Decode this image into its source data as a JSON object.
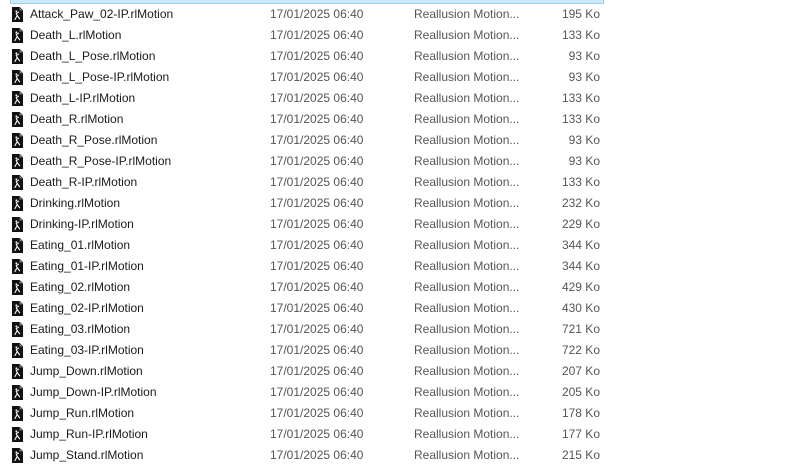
{
  "files": [
    {
      "name": "Attack_Paw_02-IP.rlMotion",
      "date": "17/01/2025 06:40",
      "type": "Reallusion Motion...",
      "size": "195 Ko"
    },
    {
      "name": "Death_L.rlMotion",
      "date": "17/01/2025 06:40",
      "type": "Reallusion Motion...",
      "size": "133 Ko"
    },
    {
      "name": "Death_L_Pose.rlMotion",
      "date": "17/01/2025 06:40",
      "type": "Reallusion Motion...",
      "size": "93 Ko"
    },
    {
      "name": "Death_L_Pose-IP.rlMotion",
      "date": "17/01/2025 06:40",
      "type": "Reallusion Motion...",
      "size": "93 Ko"
    },
    {
      "name": "Death_L-IP.rlMotion",
      "date": "17/01/2025 06:40",
      "type": "Reallusion Motion...",
      "size": "133 Ko"
    },
    {
      "name": "Death_R.rlMotion",
      "date": "17/01/2025 06:40",
      "type": "Reallusion Motion...",
      "size": "133 Ko"
    },
    {
      "name": "Death_R_Pose.rlMotion",
      "date": "17/01/2025 06:40",
      "type": "Reallusion Motion...",
      "size": "93 Ko"
    },
    {
      "name": "Death_R_Pose-IP.rlMotion",
      "date": "17/01/2025 06:40",
      "type": "Reallusion Motion...",
      "size": "93 Ko"
    },
    {
      "name": "Death_R-IP.rlMotion",
      "date": "17/01/2025 06:40",
      "type": "Reallusion Motion...",
      "size": "133 Ko"
    },
    {
      "name": "Drinking.rlMotion",
      "date": "17/01/2025 06:40",
      "type": "Reallusion Motion...",
      "size": "232 Ko"
    },
    {
      "name": "Drinking-IP.rlMotion",
      "date": "17/01/2025 06:40",
      "type": "Reallusion Motion...",
      "size": "229 Ko"
    },
    {
      "name": "Eating_01.rlMotion",
      "date": "17/01/2025 06:40",
      "type": "Reallusion Motion...",
      "size": "344 Ko"
    },
    {
      "name": "Eating_01-IP.rlMotion",
      "date": "17/01/2025 06:40",
      "type": "Reallusion Motion...",
      "size": "344 Ko"
    },
    {
      "name": "Eating_02.rlMotion",
      "date": "17/01/2025 06:40",
      "type": "Reallusion Motion...",
      "size": "429 Ko"
    },
    {
      "name": "Eating_02-IP.rlMotion",
      "date": "17/01/2025 06:40",
      "type": "Reallusion Motion...",
      "size": "430 Ko"
    },
    {
      "name": "Eating_03.rlMotion",
      "date": "17/01/2025 06:40",
      "type": "Reallusion Motion...",
      "size": "721 Ko"
    },
    {
      "name": "Eating_03-IP.rlMotion",
      "date": "17/01/2025 06:40",
      "type": "Reallusion Motion...",
      "size": "722 Ko"
    },
    {
      "name": "Jump_Down.rlMotion",
      "date": "17/01/2025 06:40",
      "type": "Reallusion Motion...",
      "size": "207 Ko"
    },
    {
      "name": "Jump_Down-IP.rlMotion",
      "date": "17/01/2025 06:40",
      "type": "Reallusion Motion...",
      "size": "205 Ko"
    },
    {
      "name": "Jump_Run.rlMotion",
      "date": "17/01/2025 06:40",
      "type": "Reallusion Motion...",
      "size": "178 Ko"
    },
    {
      "name": "Jump_Run-IP.rlMotion",
      "date": "17/01/2025 06:40",
      "type": "Reallusion Motion...",
      "size": "177 Ko"
    },
    {
      "name": "Jump_Stand.rlMotion",
      "date": "17/01/2025 06:40",
      "type": "Reallusion Motion...",
      "size": "215 Ko"
    }
  ],
  "icon": "rlmotion-file-icon"
}
